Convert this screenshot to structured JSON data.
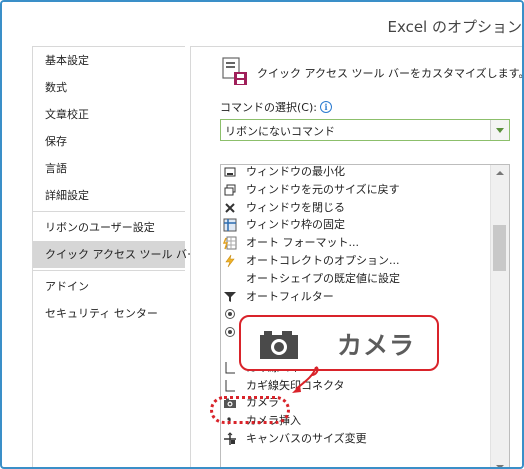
{
  "window": {
    "title": "Excel のオプション"
  },
  "sidebar": {
    "items": [
      {
        "label": "基本設定"
      },
      {
        "label": "数式"
      },
      {
        "label": "文章校正"
      },
      {
        "label": "保存"
      },
      {
        "label": "言語"
      },
      {
        "label": "詳細設定"
      },
      {
        "label": "リボンのユーザー設定"
      },
      {
        "label": "クイック アクセス ツール バー"
      },
      {
        "label": "アドイン"
      },
      {
        "label": "セキュリティ センター"
      }
    ],
    "active_index": 7
  },
  "main": {
    "header": "クイック アクセス ツール バーをカスタマイズします。",
    "command_label": "コマンドの選択(C):",
    "command_select": {
      "value": "リボンにないコマンド"
    },
    "list": [
      {
        "icon": "minimize-icon",
        "label": "ウィンドウの最小化"
      },
      {
        "icon": "restore-icon",
        "label": "ウィンドウを元のサイズに戻す"
      },
      {
        "icon": "close-x-icon",
        "label": "ウィンドウを閉じる"
      },
      {
        "icon": "freeze-panes-icon",
        "label": "ウィンドウ枠の固定"
      },
      {
        "icon": "autoformat-icon",
        "label": "オート フォーマット..."
      },
      {
        "icon": "autocorrect-icon",
        "label": "オートコレクトのオプション..."
      },
      {
        "icon": "",
        "label": "オートシェイプの既定値に設定"
      },
      {
        "icon": "filter-icon",
        "label": "オートフィルター"
      },
      {
        "icon": "radio-icon",
        "label": ""
      },
      {
        "icon": "radio-icon",
        "label": ""
      },
      {
        "icon": "",
        "label": ""
      },
      {
        "icon": "curve-connector-icon",
        "label": "カギ線コネ"
      },
      {
        "icon": "curve-arrow-connector-icon",
        "label": "カギ線矢印コネクタ"
      },
      {
        "icon": "camera-icon",
        "label": "カメラ"
      },
      {
        "icon": "comma-icon",
        "label": "カメラ挿入"
      },
      {
        "icon": "canvas-resize-icon",
        "label": "キャンバスのサイズ変更"
      }
    ]
  },
  "callout": {
    "text": "カメラ"
  },
  "colors": {
    "accent": "#d9232a",
    "frame": "#3a8fc8",
    "dropdown_border": "#8cbf6b"
  }
}
